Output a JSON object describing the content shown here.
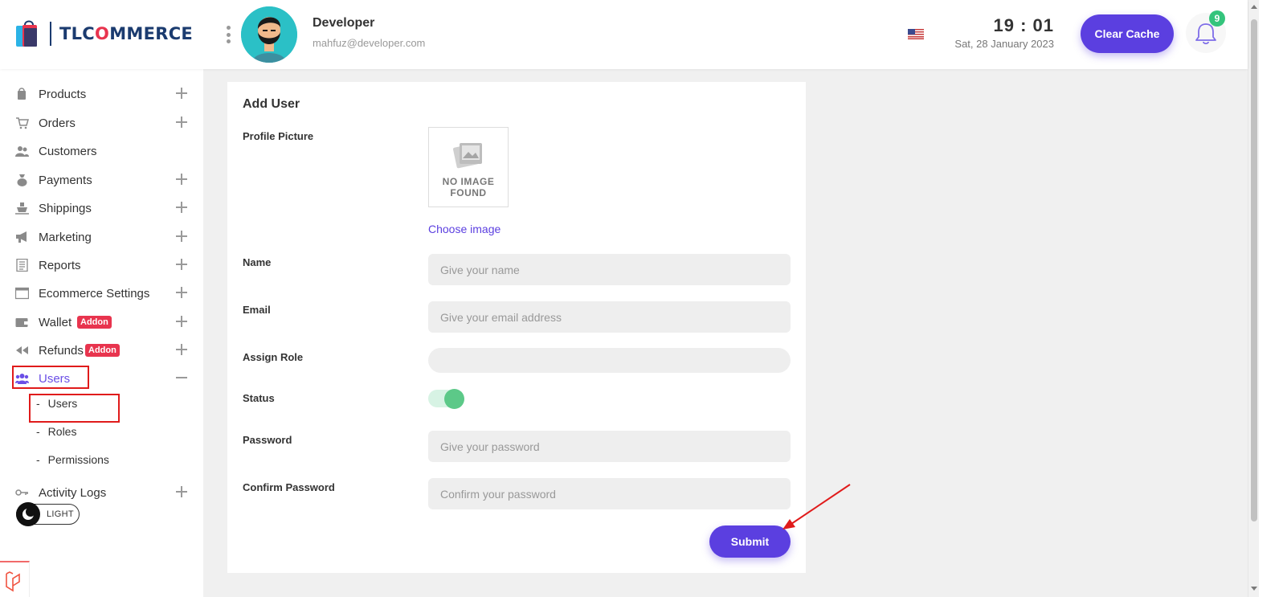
{
  "header": {
    "brand": {
      "prefix": "TLC",
      "o": "O",
      "suffix": "MMERCE"
    },
    "user": {
      "name": "Developer",
      "email": "mahfuz@developer.com"
    },
    "clock": {
      "time": "19 : 01",
      "date": "Sat, 28 January 2023"
    },
    "clear_cache_label": "Clear Cache",
    "notifications_count": "9",
    "language_flag": "us-flag-icon"
  },
  "sidebar": {
    "items": [
      {
        "label": "Products",
        "icon": "products-icon",
        "expand": "plus"
      },
      {
        "label": "Orders",
        "icon": "cart-icon",
        "expand": "plus"
      },
      {
        "label": "Customers",
        "icon": "customers-icon",
        "expand": "none"
      },
      {
        "label": "Payments",
        "icon": "money-bag-icon",
        "expand": "plus"
      },
      {
        "label": "Shippings",
        "icon": "ship-icon",
        "expand": "plus"
      },
      {
        "label": "Marketing",
        "icon": "megaphone-icon",
        "expand": "plus"
      },
      {
        "label": "Reports",
        "icon": "report-icon",
        "expand": "plus"
      },
      {
        "label": "Ecommerce Settings",
        "icon": "window-icon",
        "expand": "plus"
      },
      {
        "label": "Wallet",
        "icon": "wallet-icon",
        "expand": "plus",
        "badge": "Addon"
      },
      {
        "label": "Refunds",
        "icon": "rewind-icon",
        "expand": "plus",
        "badge": "Addon"
      },
      {
        "label": "Users",
        "icon": "users-icon",
        "expand": "minus",
        "active": true
      }
    ],
    "sub_items": [
      {
        "label": "Users",
        "active": true
      },
      {
        "label": "Roles"
      },
      {
        "label": "Permissions"
      }
    ],
    "activity": {
      "label": "Activity Logs",
      "icon": "key-icon"
    },
    "theme_label": "LIGHT"
  },
  "form": {
    "title": "Add User",
    "profile_picture_label": "Profile Picture",
    "no_image_line1": "NO IMAGE",
    "no_image_line2": "FOUND",
    "choose_image": "Choose image",
    "name_label": "Name",
    "name_placeholder": "Give your name",
    "email_label": "Email",
    "email_placeholder": "Give your email address",
    "role_label": "Assign Role",
    "status_label": "Status",
    "status_on": true,
    "password_label": "Password",
    "password_placeholder": "Give your password",
    "confirm_label": "Confirm Password",
    "confirm_placeholder": "Confirm your password",
    "submit_label": "Submit"
  },
  "colors": {
    "accent": "#5b3fe0",
    "brand": "#1b3b6f",
    "badge": "#e8344e",
    "success": "#5cc988",
    "annotation": "#e01b1b"
  }
}
